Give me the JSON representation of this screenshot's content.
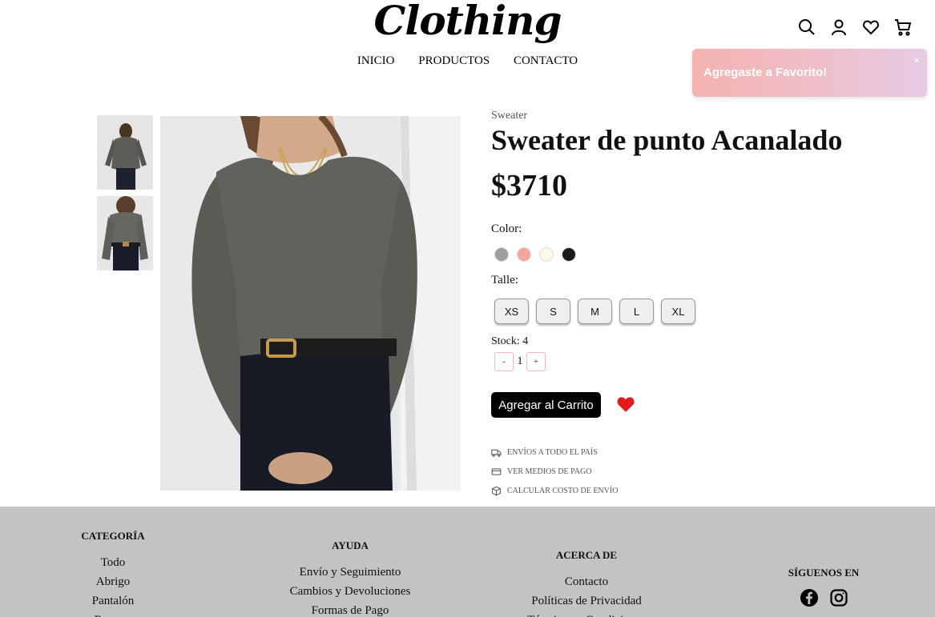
{
  "header": {
    "logo": "Clothing",
    "nav": [
      "INICIO",
      "PRODUCTOS",
      "CONTACTO"
    ],
    "icons": [
      "search-icon",
      "user-icon",
      "heart-icon",
      "cart-icon"
    ]
  },
  "toast": {
    "message": "Agregaste a Favorito!",
    "close": "×"
  },
  "product": {
    "category": "Sweater",
    "title": "Sweater de punto Acanalado",
    "price": "$3710",
    "color_label": "Color:",
    "colors": [
      "#9e9e9e",
      "#f4a69d",
      "#fdf8ea",
      "#1b1b1b"
    ],
    "size_label": "Talle:",
    "sizes": [
      "XS",
      "S",
      "M",
      "L",
      "XL"
    ],
    "stock_label": "Stock: 4",
    "quantity": {
      "minus": "-",
      "value": "1",
      "plus": "+"
    },
    "add_to_cart": "Agregar al Carrito",
    "favorite_color": "#e41b1b",
    "info": [
      {
        "icon": "truck-icon",
        "text": "Envíos a todo el país"
      },
      {
        "icon": "card-icon",
        "text": "Ver medios de pago"
      },
      {
        "icon": "box-icon",
        "text": "Calcular costo de envío"
      }
    ]
  },
  "footer": {
    "categoria": {
      "title": "CATEGORÍA",
      "links": [
        "Todo",
        "Abrigo",
        "Pantalón",
        "Remera"
      ]
    },
    "ayuda": {
      "title": "AYUDA",
      "links": [
        "Envío y Seguimiento",
        "Cambios y Devoluciones",
        "Formas de Pago"
      ]
    },
    "acerca": {
      "title": "ACERCA DE",
      "links": [
        "Contacto",
        "Políticas de Privacidad",
        "Términos y Condiciones"
      ]
    },
    "siguenos": {
      "title": "SÍGUENOS EN",
      "icons": [
        "facebook-icon",
        "instagram-icon"
      ]
    }
  }
}
